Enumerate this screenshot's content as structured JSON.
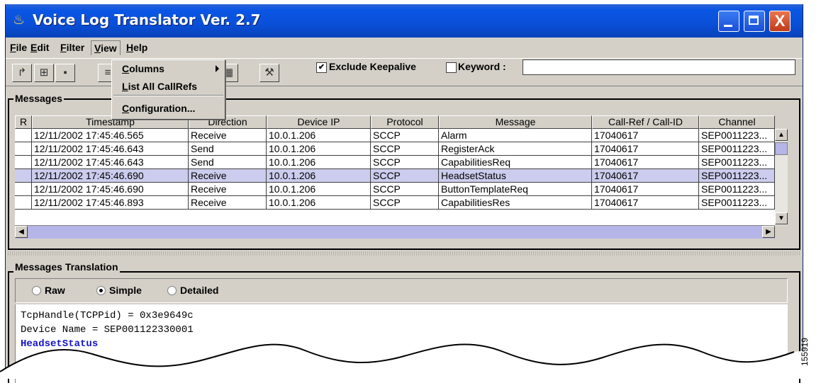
{
  "window": {
    "title": "Voice Log Translator Ver. 2.7",
    "close_glyph": "X",
    "colors": {
      "titlebar": "#0a4fd8",
      "selection": "#ccccee",
      "highlight_text": "#1414c8"
    }
  },
  "menubar": {
    "items": [
      {
        "label": "File",
        "mnemonic": "F",
        "rest": "ile"
      },
      {
        "label": "Edit",
        "mnemonic": "E",
        "rest": "dit"
      },
      {
        "label": "Filter",
        "mnemonic": "F",
        "rest": "ilter"
      },
      {
        "label": "View",
        "mnemonic": "V",
        "rest": "iew"
      },
      {
        "label": "Help",
        "mnemonic": "H",
        "rest": "elp"
      }
    ]
  },
  "view_menu": {
    "items": [
      {
        "pre": "",
        "mnemonic": "C",
        "rest": "olumns",
        "submenu": true
      },
      {
        "pre": "",
        "mnemonic": "L",
        "rest": "ist All CallRefs"
      },
      {
        "pre": "",
        "mnemonic": "C",
        "rest": "onfiguration..."
      }
    ]
  },
  "toolbar": {
    "icons": [
      "open-file-icon",
      "add-file-icon",
      "save-icon",
      "list-icon",
      "table-icon",
      "hammer-icon"
    ],
    "exclude_keepalive": {
      "label": "Exclude Keepalive",
      "checked": true
    },
    "keyword": {
      "label": "Keyword :",
      "checked": false,
      "value": ""
    }
  },
  "messages": {
    "title": "Messages",
    "columns": [
      "R",
      "Timestamp",
      "Direction",
      "Device IP",
      "Protocol",
      "Message",
      "Call-Ref / Call-ID",
      "Channel"
    ],
    "rows": [
      [
        "",
        "12/11/2002 17:45:46.565",
        "Receive",
        "10.0.1.206",
        "SCCP",
        "Alarm",
        "17040617",
        "SEP0011223..."
      ],
      [
        "",
        "12/11/2002 17:45:46.643",
        "Send",
        "10.0.1.206",
        "SCCP",
        "RegisterAck",
        "17040617",
        "SEP0011223..."
      ],
      [
        "",
        "12/11/2002 17:45:46.643",
        "Send",
        "10.0.1.206",
        "SCCP",
        "CapabilitiesReq",
        "17040617",
        "SEP0011223..."
      ],
      [
        "",
        "12/11/2002 17:45:46.690",
        "Receive",
        "10.0.1.206",
        "SCCP",
        "HeadsetStatus",
        "17040617",
        "SEP0011223..."
      ],
      [
        "",
        "12/11/2002 17:45:46.690",
        "Receive",
        "10.0.1.206",
        "SCCP",
        "ButtonTemplateReq",
        "17040617",
        "SEP0011223..."
      ],
      [
        "",
        "12/11/2002 17:45:46.893",
        "Receive",
        "10.0.1.206",
        "SCCP",
        "CapabilitiesRes",
        "17040617",
        "SEP0011223..."
      ]
    ],
    "selected_row": 3
  },
  "translation": {
    "title": "Messages Translation",
    "modes": [
      {
        "label": "Raw",
        "selected": false
      },
      {
        "label": "Simple",
        "selected": true
      },
      {
        "label": "Detailed",
        "selected": false
      }
    ],
    "lines": [
      "TcpHandle(TCPPid) = 0x3e9649c",
      "Device Name = SEP001122330001",
      "HeadsetStatus"
    ]
  },
  "figure_number": "155919"
}
